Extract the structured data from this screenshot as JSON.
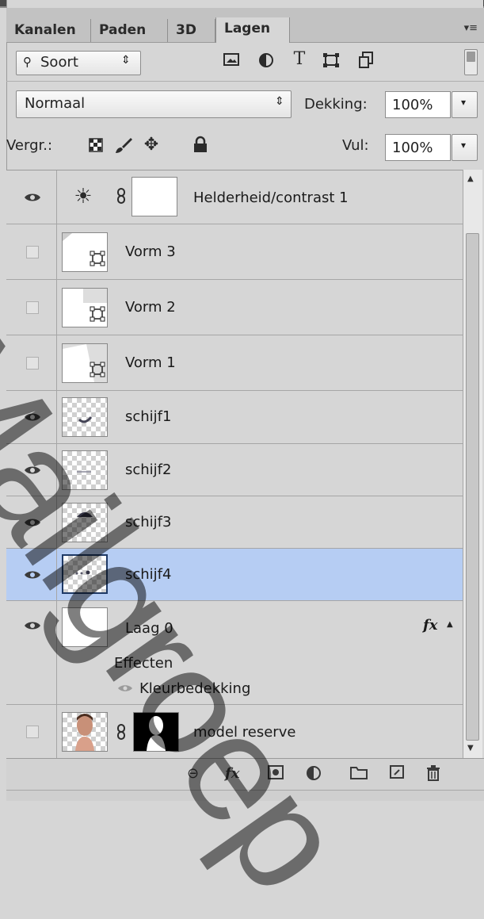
{
  "tabs": [
    {
      "label": "Kanalen"
    },
    {
      "label": "Paden"
    },
    {
      "label": "3D"
    },
    {
      "label": "Lagen"
    }
  ],
  "active_tab": "Lagen",
  "filter": {
    "kind_label": "Soort"
  },
  "blend": {
    "mode": "Normaal",
    "opacity_label": "Dekking:",
    "opacity": "100%"
  },
  "lock": {
    "label": "Vergr.:",
    "fill_label": "Vul:",
    "fill": "100%"
  },
  "layers": [
    {
      "name": "Helderheid/contrast 1",
      "visible": true,
      "type": "adjustment"
    },
    {
      "name": "Vorm 3",
      "visible": false,
      "type": "shape"
    },
    {
      "name": "Vorm 2",
      "visible": false,
      "type": "shape"
    },
    {
      "name": "Vorm 1",
      "visible": false,
      "type": "shape"
    },
    {
      "name": "schijf1",
      "visible": true,
      "type": "pixel"
    },
    {
      "name": "schijf2",
      "visible": true,
      "type": "pixel"
    },
    {
      "name": "schijf3",
      "visible": true,
      "type": "pixel"
    },
    {
      "name": "schijf4",
      "visible": true,
      "type": "pixel",
      "selected": true
    },
    {
      "name": "Laag 0",
      "visible": true,
      "type": "pixel",
      "fx": "fx",
      "effects_label": "Effecten",
      "effect": "Kleurbedekking"
    },
    {
      "name": "model reserve",
      "visible": false,
      "type": "masked"
    }
  ],
  "colors": {
    "selection": "#b6cdf3",
    "panel": "#d6d6d6"
  },
  "watermark": "Mailgroep"
}
